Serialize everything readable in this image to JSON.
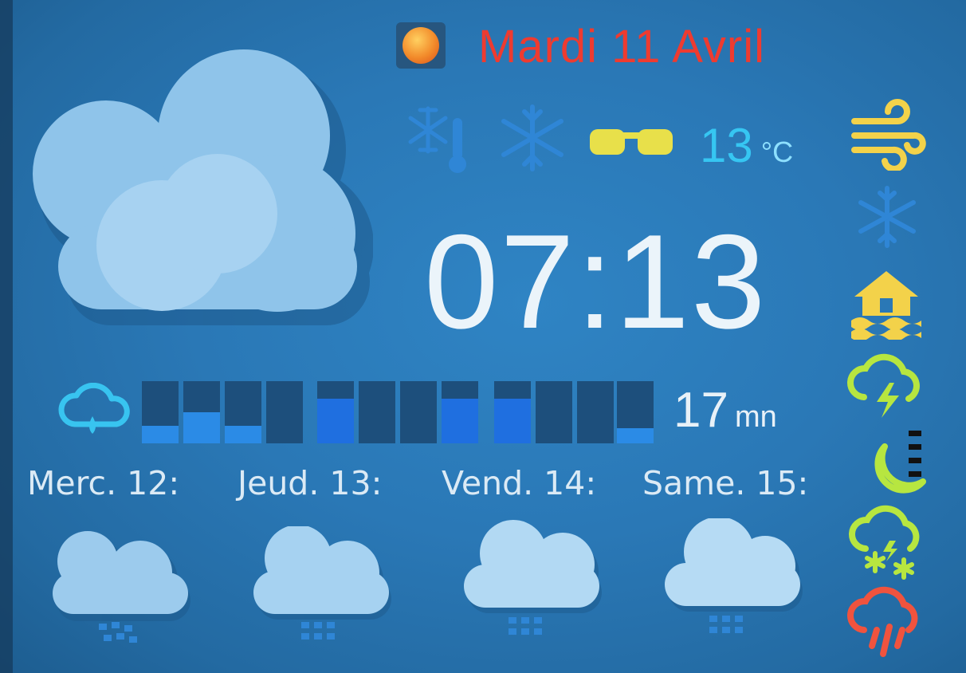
{
  "header": {
    "date": "Mardi 11 Avril",
    "temperature": "13",
    "temperature_unit": "°C"
  },
  "clock": {
    "time": "07:13"
  },
  "rain": {
    "minutes": "17",
    "minutes_unit": "mn",
    "intensity_levels": [
      0.28,
      0.5,
      0.28,
      0,
      0.72,
      0,
      0,
      0.72,
      0.72,
      0,
      0,
      0.25
    ]
  },
  "forecast": [
    {
      "day": "Merc. 12:",
      "icon": "cloud-snow-icon"
    },
    {
      "day": "Jeud. 13:",
      "icon": "cloud-snow-icon"
    },
    {
      "day": "Vend. 14:",
      "icon": "cloud-snow-icon"
    },
    {
      "day": "Same. 15:",
      "icon": "cloud-snow-icon"
    }
  ],
  "status_icons": {
    "top": [
      "thermometer-frost-icon",
      "snowflake-icon",
      "sunglasses-icon"
    ],
    "alerts": [
      "wind-icon",
      "snow-icon",
      "flood-icon",
      "thunderstorm-icon",
      "moon-icon",
      "snow-storm-icon",
      "heavy-rain-icon"
    ]
  },
  "colors": {
    "date": "#ee3b30",
    "temperature": "#36c6f2",
    "alert_yellow": "#f3d24a",
    "alert_green": "#b7e640",
    "alert_red": "#f0533e",
    "sky_light": "#38c4f0"
  }
}
